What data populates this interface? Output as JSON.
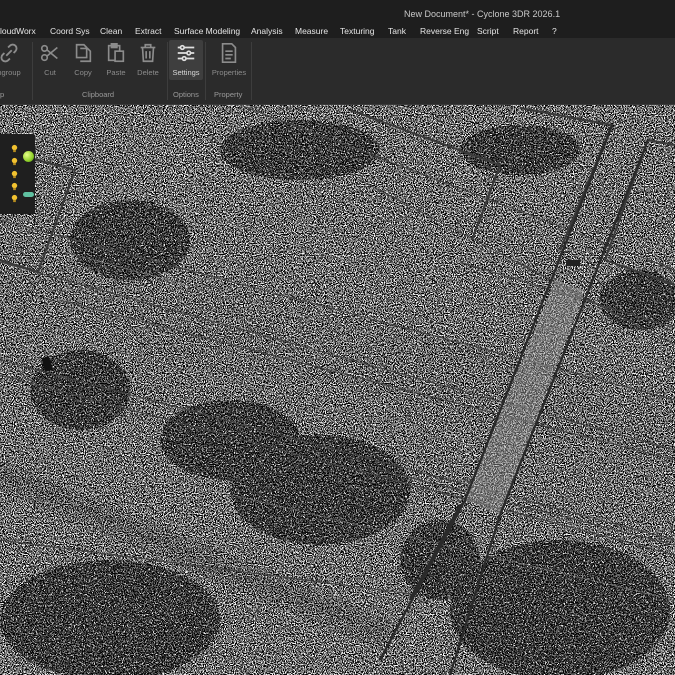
{
  "window": {
    "title": "New Document* - Cyclone 3DR 2026.1"
  },
  "menu": {
    "items": [
      {
        "label": "loudWorx"
      },
      {
        "label": "Coord Sys"
      },
      {
        "label": "Clean"
      },
      {
        "label": "Extract"
      },
      {
        "label": "Surface Modeling"
      },
      {
        "label": "Analysis"
      },
      {
        "label": "Measure"
      },
      {
        "label": "Texturing"
      },
      {
        "label": "Tank"
      },
      {
        "label": "Reverse Eng"
      },
      {
        "label": "Script"
      },
      {
        "label": "Report"
      },
      {
        "label": "?"
      }
    ]
  },
  "ribbon": {
    "buttons": [
      {
        "label": "ngroup",
        "icon": "link-icon"
      },
      {
        "label": "Cut",
        "icon": "scissors-icon"
      },
      {
        "label": "Copy",
        "icon": "copy-icon"
      },
      {
        "label": "Paste",
        "icon": "paste-icon"
      },
      {
        "label": "Delete",
        "icon": "trash-icon"
      },
      {
        "label": "Settings",
        "icon": "sliders-icon",
        "active": true
      },
      {
        "label": "Properties",
        "icon": "document-icon"
      }
    ],
    "groups": [
      {
        "label": "p"
      },
      {
        "label": "Clipboard"
      },
      {
        "label": "Options"
      },
      {
        "label": "Property"
      }
    ]
  },
  "layers_panel": {
    "chevrons": [
      "chevron-down-icon",
      "chevron-down-icon"
    ],
    "rows": [
      "bulb-icon",
      "bulb-icon",
      "bulb-icon",
      "bulb-icon",
      "bulb-icon"
    ]
  },
  "colors": {
    "titlebar": "#1e1e1e",
    "ribbon": "#2b2b2b",
    "viewport_bg": "#fdfdfd",
    "bulb": "#f2c230",
    "sphere": "#a4e03a",
    "toggle": "#5fc0a0"
  }
}
